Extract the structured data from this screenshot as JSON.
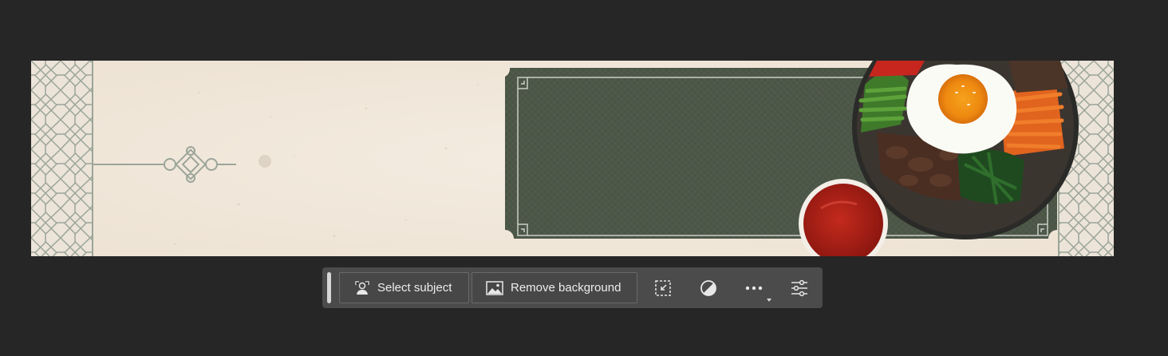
{
  "canvas": {
    "background": "#262626"
  },
  "banner": {
    "paper_color": "#f1e8dc",
    "panel_color": "#4a5546",
    "lattice_color": "#9ca59a",
    "description_icon": "bibimbap-banner-image"
  },
  "taskbar": {
    "select_subject_label": "Select subject",
    "remove_background_label": "Remove background",
    "icons": {
      "select_subject": "person-select-icon",
      "remove_background": "image-icon",
      "transform": "transform-crop-icon",
      "adjust": "half-circle-adjust-icon",
      "more": "ellipsis-icon",
      "settings": "sliders-icon"
    },
    "colors": {
      "bar": "#4b4b4b",
      "text": "#ededed",
      "border": "#6a6a6a"
    }
  }
}
